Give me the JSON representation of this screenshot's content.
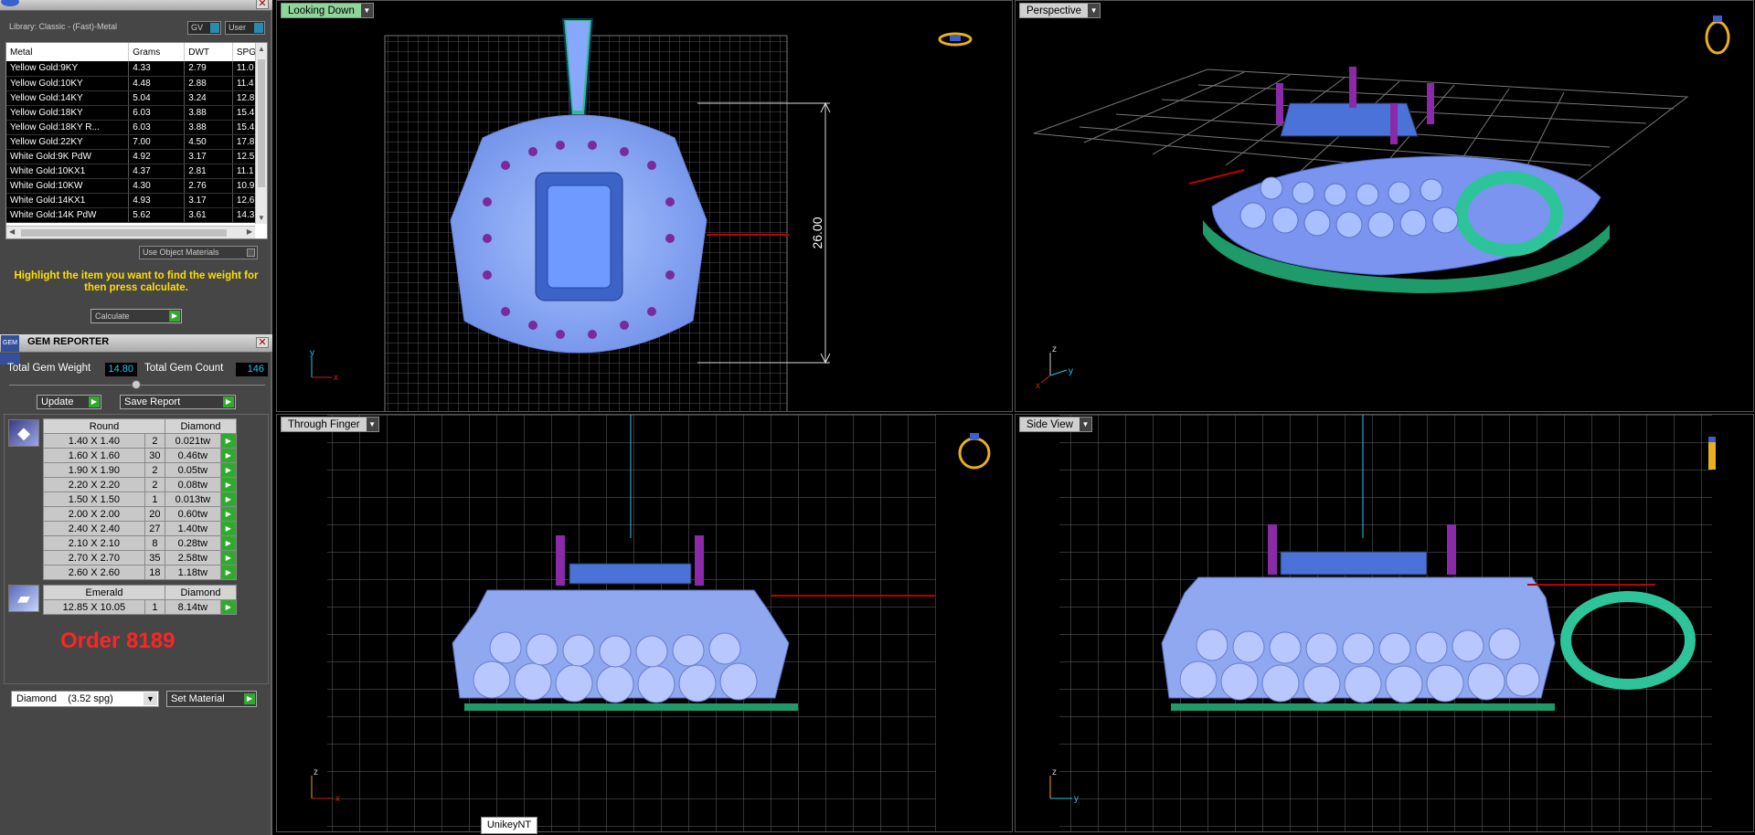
{
  "library": {
    "title": "Library: Classic - (Fast)-Metal",
    "gv_label": "GV",
    "user_label": "User",
    "columns": [
      "Metal",
      "Grams",
      "DWT",
      "SPG"
    ],
    "rows": [
      [
        "Yellow Gold:9KY",
        "4.33",
        "2.79",
        "11.0"
      ],
      [
        "Yellow Gold:10KY",
        "4.48",
        "2.88",
        "11.4"
      ],
      [
        "Yellow Gold:14KY",
        "5.04",
        "3.24",
        "12.8"
      ],
      [
        "Yellow Gold:18KY",
        "6.03",
        "3.88",
        "15.4"
      ],
      [
        "Yellow Gold:18KY R...",
        "6.03",
        "3.88",
        "15.4"
      ],
      [
        "Yellow Gold:22KY",
        "7.00",
        "4.50",
        "17.8"
      ],
      [
        "White Gold:9K PdW",
        "4.92",
        "3.17",
        "12.5"
      ],
      [
        "White Gold:10KX1",
        "4.37",
        "2.81",
        "11.1"
      ],
      [
        "White Gold:10KW",
        "4.30",
        "2.76",
        "10.9"
      ],
      [
        "White Gold:14KX1",
        "4.93",
        "3.17",
        "12.6"
      ],
      [
        "White Gold:14K PdW",
        "5.62",
        "3.61",
        "14.3"
      ]
    ],
    "use_object_materials": "Use Object Materials",
    "hint": "Highlight the item you want to find the weight for then press calculate.",
    "calculate_label": "Calculate"
  },
  "gem_reporter": {
    "title": "GEM REPORTER",
    "total_weight_label": "Total Gem Weight",
    "total_weight_value": "14.80",
    "total_count_label": "Total Gem Count",
    "total_count_value": "146",
    "update_label": "Update",
    "save_report_label": "Save Report",
    "round_header": [
      "Round",
      "Diamond"
    ],
    "round_rows": [
      [
        "1.40 X 1.40",
        "2",
        "0.021tw"
      ],
      [
        "1.60 X 1.60",
        "30",
        "0.46tw"
      ],
      [
        "1.90 X 1.90",
        "2",
        "0.05tw"
      ],
      [
        "2.20 X 2.20",
        "2",
        "0.08tw"
      ],
      [
        "1.50 X 1.50",
        "1",
        "0.013tw"
      ],
      [
        "2.00 X 2.00",
        "20",
        "0.60tw"
      ],
      [
        "2.40 X 2.40",
        "27",
        "1.40tw"
      ],
      [
        "2.10 X 2.10",
        "8",
        "0.28tw"
      ],
      [
        "2.70 X 2.70",
        "35",
        "2.58tw"
      ],
      [
        "2.60 X 2.60",
        "18",
        "1.18tw"
      ]
    ],
    "emerald_header": [
      "Emerald",
      "Diamond"
    ],
    "emerald_rows": [
      [
        "12.85 X 10.05",
        "1",
        "8.14tw"
      ]
    ],
    "order_text": "Order 8189",
    "material_value": "Diamond    (3.52 spg)",
    "set_material_label": "Set Material"
  },
  "viewports": {
    "top_left": {
      "label": "Looking Down",
      "dimension": "26.00"
    },
    "top_right": {
      "label": "Perspective"
    },
    "bottom_left": {
      "label": "Through Finger"
    },
    "bottom_right": {
      "label": "Side View"
    }
  },
  "taskbar_label": "UnikeyNT"
}
